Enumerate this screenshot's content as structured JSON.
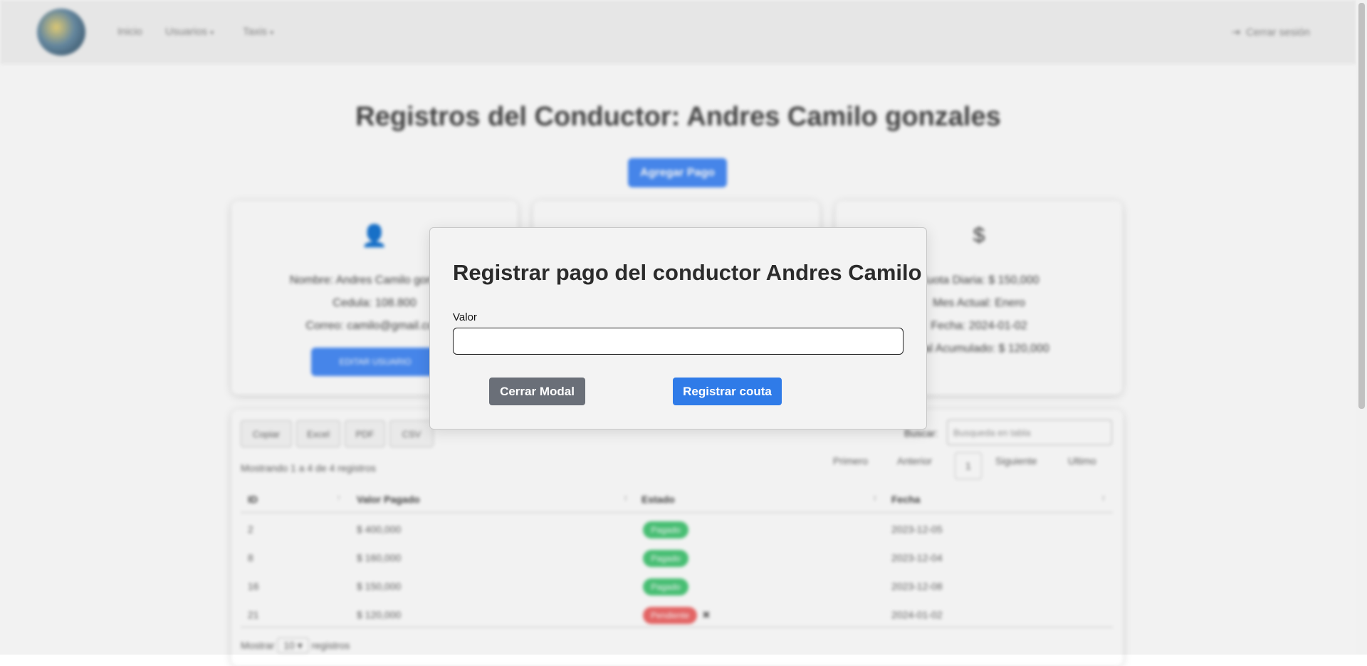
{
  "nav": {
    "items": [
      {
        "label": "Inicio"
      },
      {
        "label": "Usuarios"
      },
      {
        "label": "Taxis"
      }
    ],
    "logout_label": "Cerrar sesión"
  },
  "page": {
    "title": "Registros del Conductor: Andres Camilo gonzales",
    "add_button": "Agregar Pago"
  },
  "cards": {
    "driver": {
      "icon": "user-icon",
      "lines": [
        "Nombre: Andres Camilo gonzales",
        "Cedula: 108.800",
        "Correo: camilo@gmail.com"
      ],
      "button": "EDITAR USUARIO"
    },
    "payment": {
      "icon": "dollar-icon",
      "lines": [
        "Cuota Diaria: $ 150,000",
        "Mes Actual: Enero",
        "Fecha: 2024-01-02",
        "Total Acumulado: $ 120,000"
      ]
    }
  },
  "table": {
    "export_buttons": [
      "Copiar",
      "Excel",
      "PDF",
      "CSV"
    ],
    "search_label": "Buscar:",
    "search_placeholder": "Busqueda en tabla",
    "info": "Mostrando 1 a 4 de 4 registros",
    "pagination": [
      "Primero",
      "Anterior",
      "1",
      "Siguiente",
      "Ultimo"
    ],
    "columns": [
      "ID",
      "Valor Pagado",
      "Estado",
      "Fecha"
    ],
    "rows": [
      {
        "id": "2",
        "valor": "$ 400,000",
        "estado": "Pagado",
        "fecha": "2023-12-05"
      },
      {
        "id": "8",
        "valor": "$ 160,000",
        "estado": "Pagado",
        "fecha": "2023-12-04"
      },
      {
        "id": "16",
        "valor": "$ 150,000",
        "estado": "Pagado",
        "fecha": "2023-12-08"
      },
      {
        "id": "21",
        "valor": "$ 120,000",
        "estado": "Pendiente",
        "fecha": "2024-01-02"
      }
    ],
    "footer_show": "Mostrar",
    "footer_count": "10",
    "footer_suffix": "registros"
  },
  "modal": {
    "title": "Registrar pago del conductor Andres Camilo",
    "field_label": "Valor",
    "field_value": "",
    "close_button": "Cerrar Modal",
    "submit_button": "Registrar couta"
  },
  "colors": {
    "primary": "#2f7be8",
    "secondary": "#6a6f78",
    "success": "#4cc97a",
    "danger": "#f06b6b"
  }
}
